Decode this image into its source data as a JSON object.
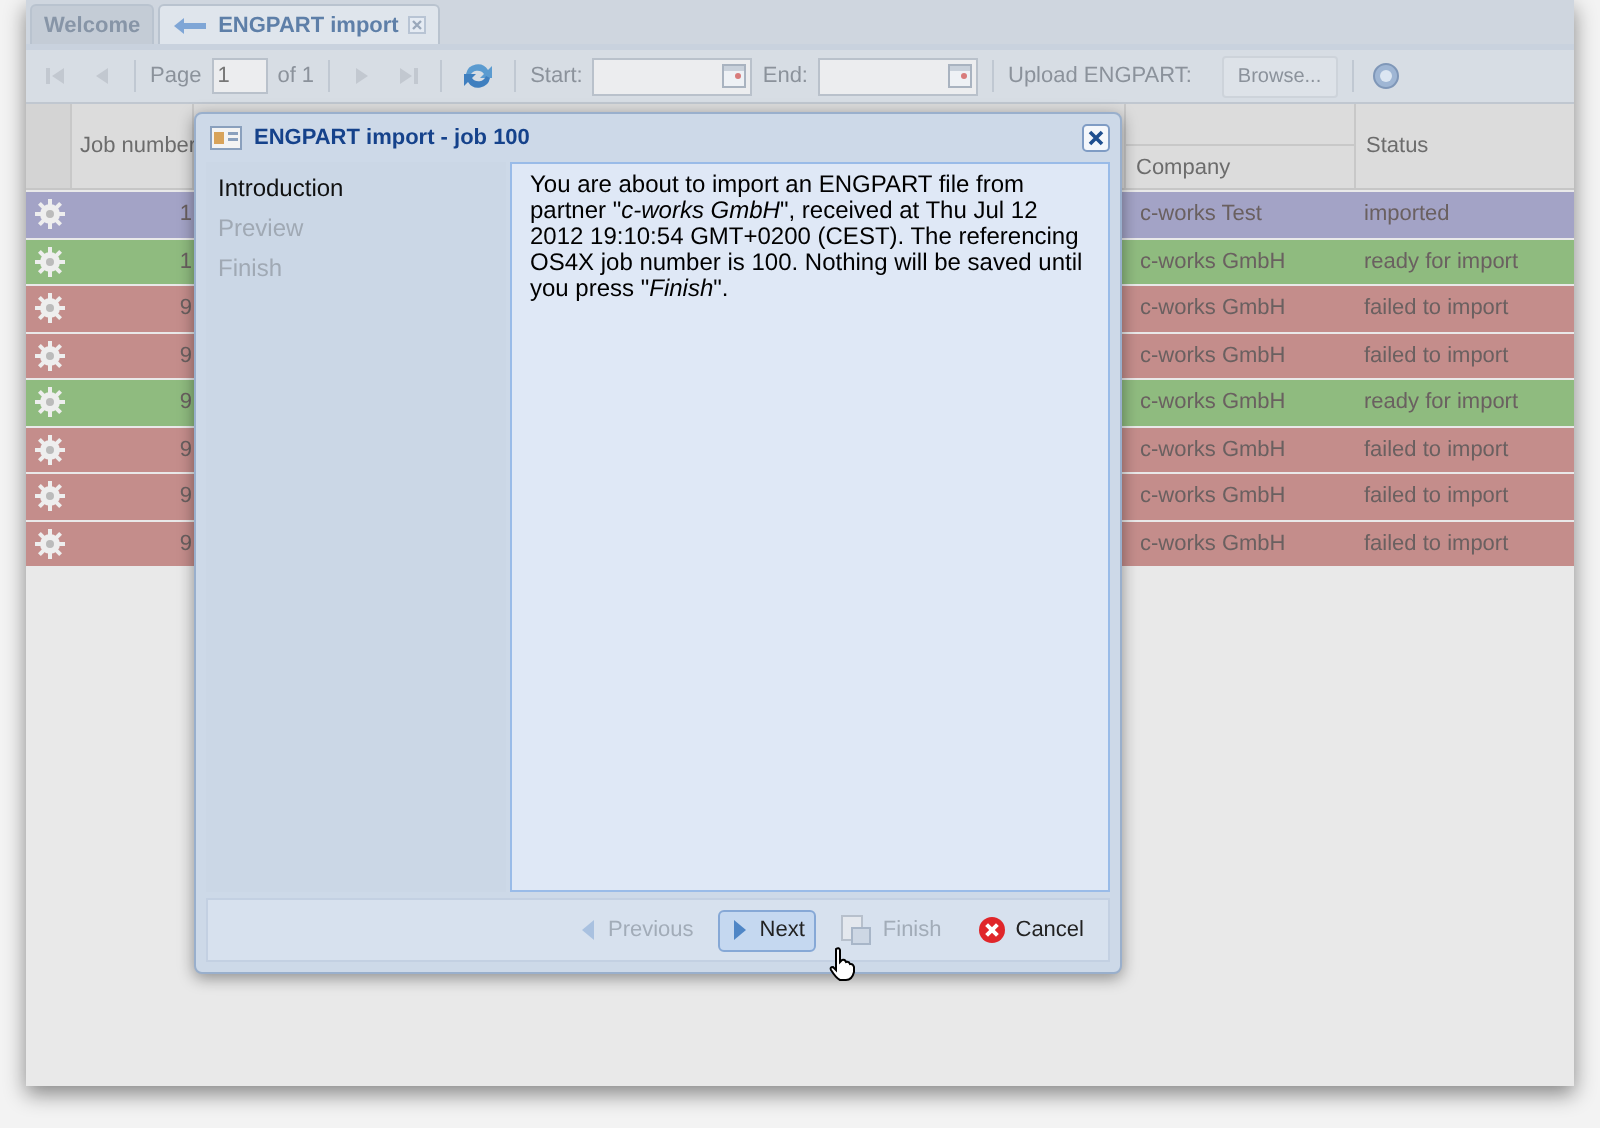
{
  "tabs": [
    {
      "label": "Welcome",
      "selected": false,
      "closable": false
    },
    {
      "label": "ENGPART import",
      "selected": true,
      "closable": true
    }
  ],
  "toolbar": {
    "page_label": "Page",
    "page": "1",
    "page_count": "of 1",
    "start_label": "Start:",
    "end_label": "End:",
    "upload_label": "Upload ENGPART:",
    "browse_button": "Browse..."
  },
  "table": {
    "columns": [
      "Job number",
      "Company",
      "Status"
    ],
    "rows": [
      {
        "job_number": "1",
        "company": "c-works Test",
        "status": "imported",
        "color": "#a3a3c6"
      },
      {
        "job_number": "1",
        "company": "c-works GmbH",
        "status": "ready for import",
        "color": "#8fbb7f"
      },
      {
        "job_number": "9",
        "company": "c-works GmbH",
        "status": "failed to import",
        "color": "#c48d8b"
      },
      {
        "job_number": "9",
        "company": "c-works GmbH",
        "status": "failed to import",
        "color": "#c48d8b"
      },
      {
        "job_number": "9",
        "company": "c-works GmbH",
        "status": "ready for import",
        "color": "#8fbb7f"
      },
      {
        "job_number": "9",
        "company": "c-works GmbH",
        "status": "failed to import",
        "color": "#c48d8b"
      },
      {
        "job_number": "9",
        "company": "c-works GmbH",
        "status": "failed to import",
        "color": "#c48d8b"
      },
      {
        "job_number": "9",
        "company": "c-works GmbH",
        "status": "failed to import",
        "color": "#c48d8b"
      }
    ]
  },
  "dialog": {
    "title": "ENGPART import - job 100",
    "steps": [
      {
        "label": "Introduction",
        "selected": true
      },
      {
        "label": "Preview",
        "selected": false
      },
      {
        "label": "Finish",
        "selected": false
      }
    ],
    "message": "You are about to import an ENGPART file from partner \"*c-works GmbH*\", received at Thu Jul 12 2012 19:10:54 GMT+0200 (CEST). The referencing OS4X job number is 100. Nothing will be saved until you press \"*Finish*\".",
    "buttons": [
      {
        "kind": "previous",
        "label": "Previous",
        "disabled": true
      },
      {
        "kind": "next",
        "label": "Next",
        "disabled": false
      },
      {
        "kind": "finish",
        "label": "Finish",
        "disabled": true
      },
      {
        "kind": "cancel",
        "label": "Cancel",
        "disabled": false
      }
    ]
  }
}
